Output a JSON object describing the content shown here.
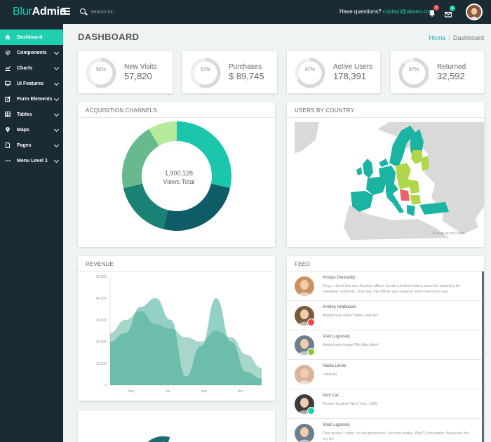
{
  "app": {
    "logo_first": "Blur",
    "logo_second": "Admin"
  },
  "header": {
    "search_placeholder": "Search for...",
    "questions_label": "Have questions?",
    "contact_email": "contact@akveo.com",
    "notifications_count": "5",
    "messages_count": "5"
  },
  "sidebar": {
    "items": [
      {
        "label": "Dashboard",
        "icon": "home-icon",
        "active": true
      },
      {
        "label": "Components",
        "icon": "gear-icon"
      },
      {
        "label": "Charts",
        "icon": "chart-icon"
      },
      {
        "label": "UI Features",
        "icon": "monitor-icon"
      },
      {
        "label": "Form Elements",
        "icon": "edit-icon"
      },
      {
        "label": "Tables",
        "icon": "grid-icon"
      },
      {
        "label": "Maps",
        "icon": "map-pin-icon"
      },
      {
        "label": "Pages",
        "icon": "page-icon"
      },
      {
        "label": "Menu Level 1",
        "icon": "ellipsis-icon"
      }
    ]
  },
  "page": {
    "title": "DASHBOARD",
    "breadcrumb_home": "Home",
    "breadcrumb_separator": "/",
    "breadcrumb_current": "Dashboard"
  },
  "stats": [
    {
      "label": "New Visits",
      "value": "57,820",
      "percent": "56%",
      "fraction": 0.56
    },
    {
      "label": "Purchases",
      "value": "$ 89,745",
      "percent": "57%",
      "fraction": 0.57
    },
    {
      "label": "Active Users",
      "value": "178,391",
      "percent": "67%",
      "fraction": 0.67
    },
    {
      "label": "Returned",
      "value": "32,592",
      "percent": "87%",
      "fraction": 0.87
    }
  ],
  "acquisition": {
    "title": "ACQUISITION CHANNELS",
    "total_value": "1,900,128",
    "total_label": "Views Total",
    "segments": [
      {
        "share": 0.285,
        "color": "#1bc6ad"
      },
      {
        "share": 0.255,
        "color": "#0e5c66"
      },
      {
        "share": 0.175,
        "color": "#1a8275"
      },
      {
        "share": 0.2,
        "color": "#69b98e"
      },
      {
        "share": 0.085,
        "color": "#b4ea99"
      }
    ]
  },
  "users_by_country": {
    "title": "USERS BY COUNTRY",
    "credit": "JS map by amCharts"
  },
  "revenue": {
    "title": "REVENUE",
    "chart_data": {
      "type": "area",
      "x_ticks": [
        "May",
        "Jul",
        "Sep",
        "Nov"
      ],
      "y_ticks": [
        "0",
        "10,000",
        "20,000",
        "30,000",
        "40,000",
        "50,000"
      ],
      "ylim": [
        0,
        50000
      ],
      "series": [
        {
          "values": [
            24000,
            30000,
            34000,
            28000,
            26000,
            22000,
            20000,
            25000,
            22000,
            14000,
            8000
          ]
        },
        {
          "values": [
            20000,
            24000,
            36000,
            40000,
            30000,
            4000,
            18000,
            40000,
            20000,
            6000,
            3000
          ]
        }
      ]
    }
  },
  "feed": {
    "title": "FEED",
    "items": [
      {
        "name": "Kostya Danovsky",
        "text": "Guys, check this out: A police officer found a perfect hiding place for watching for speeding motorists. One day, the officer was amazed when everyone was",
        "avatar_color": "#c9925f",
        "badge_color": ""
      },
      {
        "name": "Andrey Hrabouski",
        "text": "Added new video\"Vader and Me\"",
        "avatar_color": "#7a5a3c",
        "badge_color": "#e84c4c"
      },
      {
        "name": "Vlad Lugovsky",
        "text": "Added new image\"My little kitten\"",
        "avatar_color": "#6b7f8c",
        "badge_color": "#8fc43c"
      },
      {
        "name": "Nasta Linnie",
        "text": "Haha lol",
        "avatar_color": "#d9b49a",
        "badge_color": ""
      },
      {
        "name": "Nick Cat",
        "text": "Posted location\"New York, USA\"",
        "avatar_color": "#3c3c3c",
        "badge_color": "#1fcfad"
      },
      {
        "name": "Vlad Lugovsky",
        "text": "First snake: I hope I'm not poisonous. Second snake: Why? First snake: Because I bit my lip!",
        "avatar_color": "#6b7f8c",
        "badge_color": ""
      }
    ]
  },
  "colors": {
    "accent": "#1fcfad",
    "sidebar_bg": "#1a2b34",
    "map_highlight": "#1bb3a2",
    "map_light_green": "#b0d74b",
    "map_land": "#d9d9d9"
  }
}
